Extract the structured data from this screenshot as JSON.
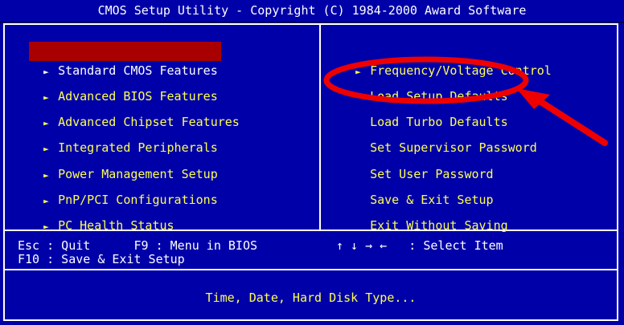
{
  "title": "CMOS Setup Utility - Copyright (C) 1984-2000 Award Software",
  "left_menu": [
    {
      "label": "Standard CMOS Features",
      "arrow": "►"
    },
    {
      "label": "Advanced BIOS Features",
      "arrow": "►"
    },
    {
      "label": "Advanced Chipset Features",
      "arrow": "►"
    },
    {
      "label": "Integrated Peripherals",
      "arrow": "►"
    },
    {
      "label": "Power Management Setup",
      "arrow": "►"
    },
    {
      "label": "PnP/PCI Configurations",
      "arrow": "►"
    },
    {
      "label": "PC Health Status",
      "arrow": "►"
    }
  ],
  "right_menu": [
    {
      "label": "Frequency/Voltage Control",
      "arrow": "►"
    },
    {
      "label": "Load Setup Defaults"
    },
    {
      "label": "Load Turbo Defaults"
    },
    {
      "label": "Set Supervisor Password"
    },
    {
      "label": "Set User Password"
    },
    {
      "label": "Save & Exit Setup"
    },
    {
      "label": "Exit Without Saving"
    }
  ],
  "help": {
    "line1_left": "Esc : Quit      F9 : Menu in BIOS",
    "line1_right": "↑ ↓ → ←   : Select Item",
    "line2": "F10 : Save & Exit Setup"
  },
  "status_text": "Time, Date, Hard Disk Type...",
  "colors": {
    "background": "#0000a8",
    "highlight": "#a80000",
    "menu_text": "#ffff55",
    "annotation": "#ee0000"
  },
  "annotation": {
    "type": "red-ellipse-with-arrow",
    "target": "Load Setup Defaults"
  }
}
